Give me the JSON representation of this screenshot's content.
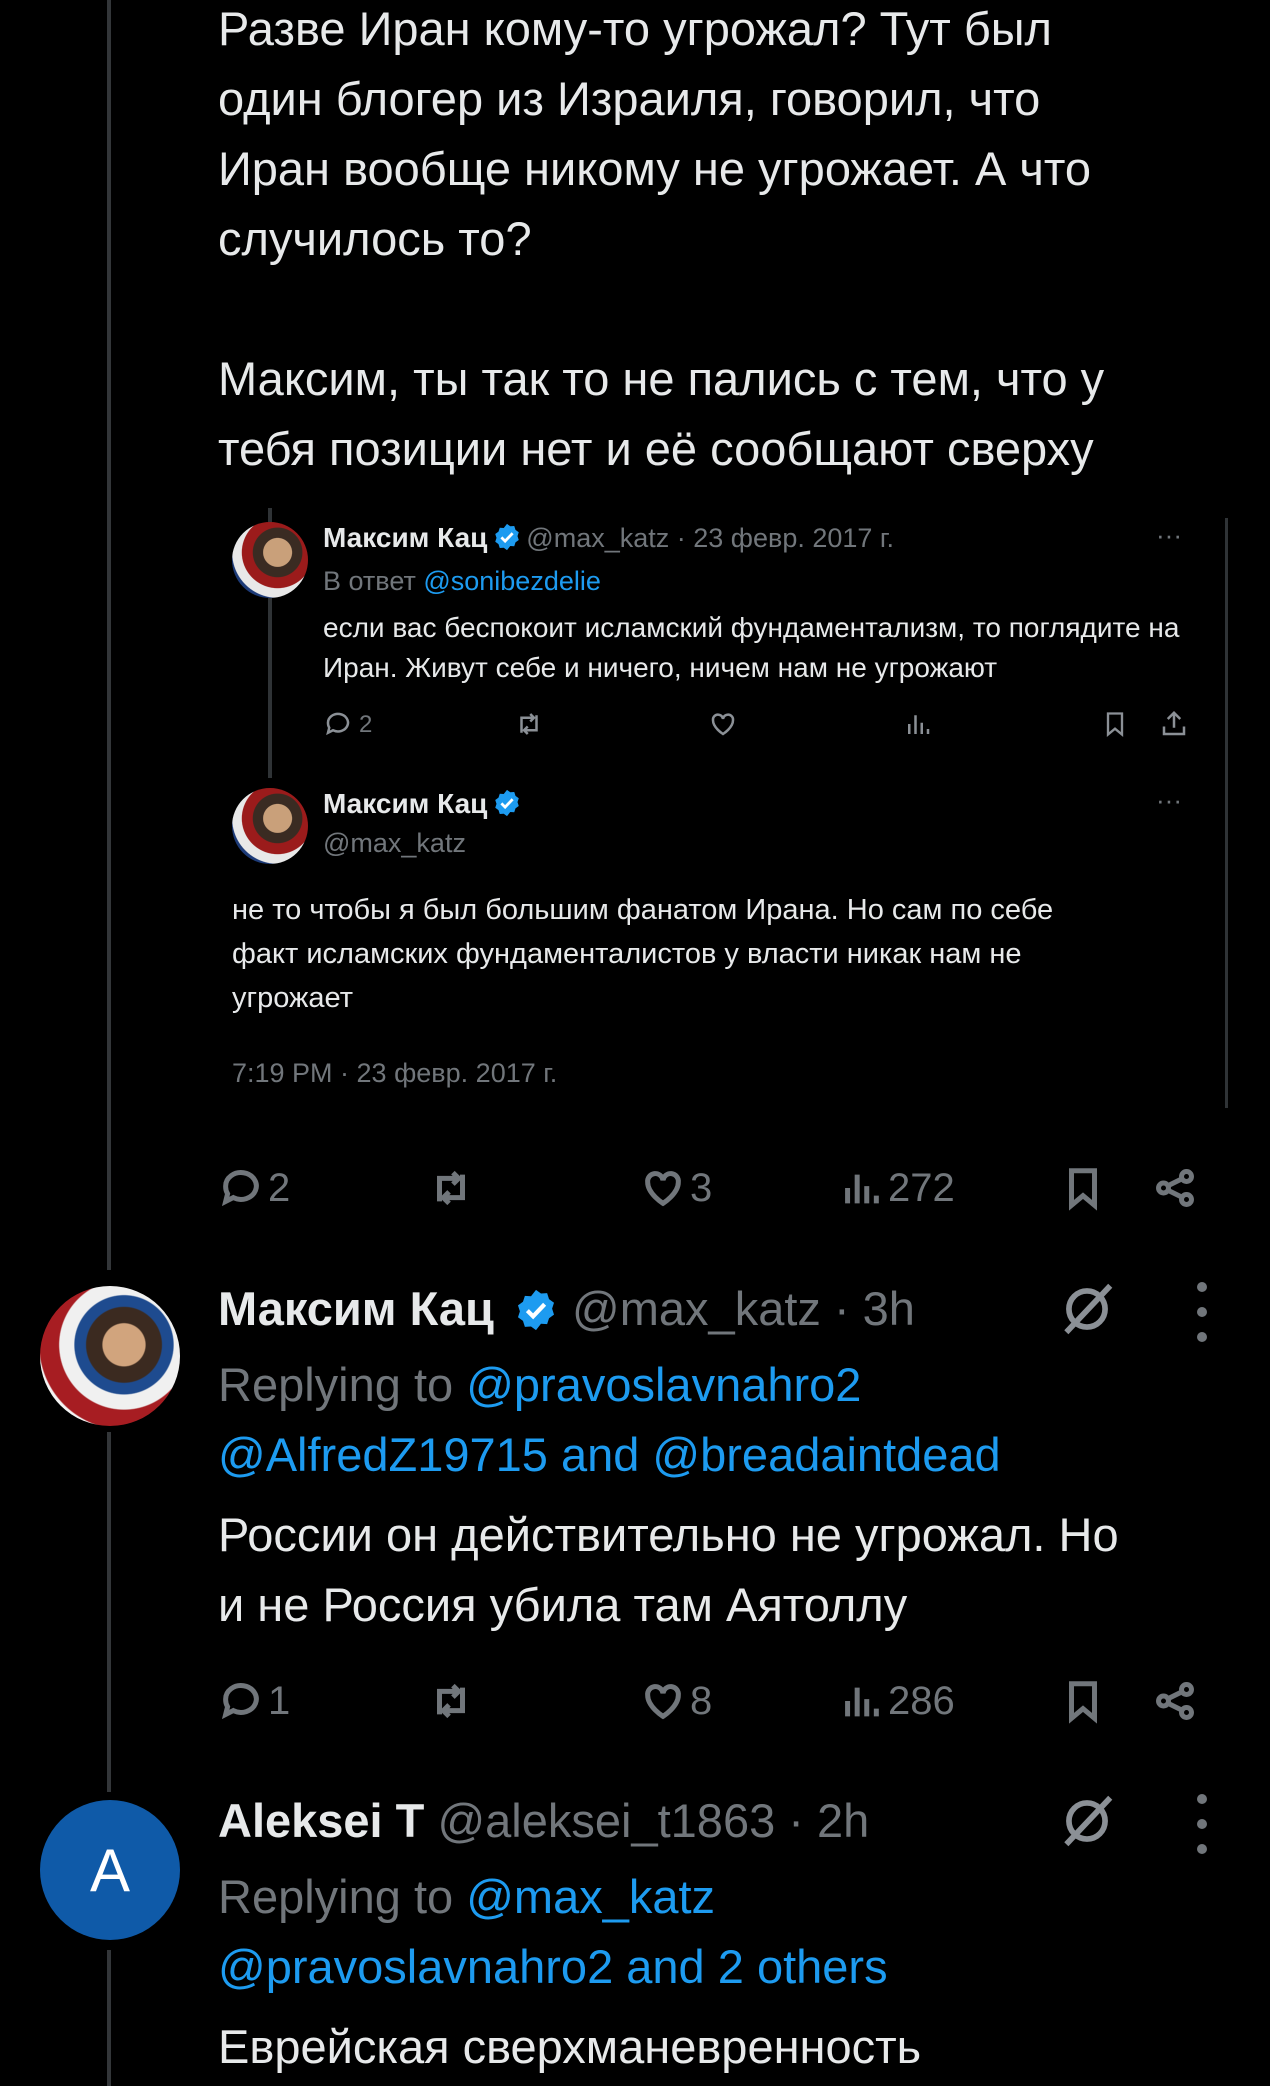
{
  "post1": {
    "paragraph1": [
      "Разве Иран кому-то угрожал? Тут был",
      "один блогер из Израиля, говорил, что",
      "Иран вообще никому не угрожает. А что",
      "случилось то?"
    ],
    "paragraph2": [
      "Максим, ты так то не пались с тем, что у",
      "тебя позиции нет и её сообщают сверху"
    ],
    "quoted": {
      "tweet1": {
        "name": "Максим Кац",
        "meta": "@max_katz · 23 февр. 2017 г.",
        "reply_prefix": "В ответ",
        "reply_handle": "@sonibezdelie",
        "text": [
          "если вас беспокоит исламский фундаментализм, то поглядите на",
          "Иран. Живут себе и ничего, ничем нам не угрожают"
        ],
        "replies": "2"
      },
      "tweet2": {
        "name": "Максим Кац",
        "handle": "@max_katz",
        "text": [
          "не то чтобы я был большим фанатом Ирана. Но сам по себе",
          "факт исламских фундаменталистов у власти никак нам не",
          "угрожает"
        ],
        "timestamp": "7:19 PM · 23 февр. 2017 г."
      }
    },
    "actions": {
      "replies": "2",
      "likes": "3",
      "views": "272"
    }
  },
  "post2": {
    "name": "Максим Кац",
    "handle": "@max_katz",
    "time": "· 3h",
    "replying_prefix": "Replying to",
    "replying_line1": "@pravoslavnahro2",
    "replying_line2": "@AlfredZ19715 and @breadaintdead",
    "text": [
      "России он действительно не угрожал. Но",
      "и не Россия убила там Аятоллу"
    ],
    "actions": {
      "replies": "1",
      "likes": "8",
      "views": "286"
    }
  },
  "post3": {
    "avatar_letter": "A",
    "name": "Aleksei T",
    "handle": "@aleksei_t1863",
    "time": "· 2h",
    "replying_prefix": "Replying to",
    "replying_line1": "@max_katz",
    "replying_line2": "@pravoslavnahro2 and 2 others",
    "text": [
      "Еврейская сверхманевренность"
    ]
  },
  "colors": {
    "background": "#000000",
    "text": "#e7e9ea",
    "muted": "#71767b",
    "link": "#1d9bf0",
    "verified": "#1d9bf0"
  }
}
